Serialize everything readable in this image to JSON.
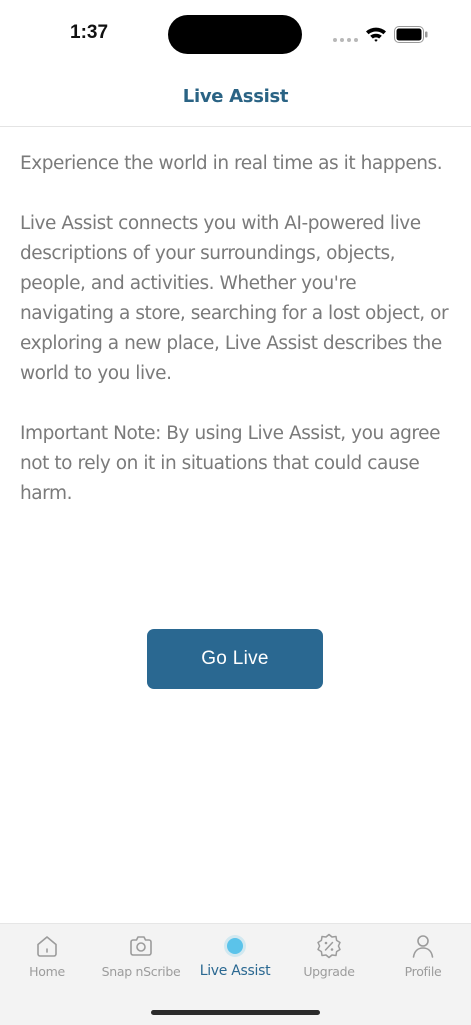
{
  "status_bar": {
    "time": "1:37"
  },
  "header": {
    "title": "Live Assist"
  },
  "content": {
    "paragraphs": [
      "Experience the world in real time as it happens.",
      "Live Assist connects you with AI-powered live descriptions of your surroundings, objects, people, and activities. Whether you're navigating a store, searching for a lost object, or exploring a new place, Live Assist describes the world to you live.",
      "Important Note: By using Live Assist, you agree not to rely on it in situations that could cause harm."
    ]
  },
  "actions": {
    "go_live_label": "Go Live"
  },
  "tab_bar": {
    "active_index": 2,
    "tabs": [
      {
        "label": "Home",
        "icon": "home-icon"
      },
      {
        "label": "Snap nScribe",
        "icon": "camera-icon"
      },
      {
        "label": "Live Assist",
        "icon": "live-dot-icon"
      },
      {
        "label": "Upgrade",
        "icon": "discount-badge-icon"
      },
      {
        "label": "Profile",
        "icon": "person-icon"
      }
    ]
  },
  "colors": {
    "accent": "#2a6891",
    "title": "#2a6384",
    "body_text": "#7a7a7a",
    "inactive_tab": "#9c9c9c",
    "live_dot": "#5bc3ea"
  }
}
